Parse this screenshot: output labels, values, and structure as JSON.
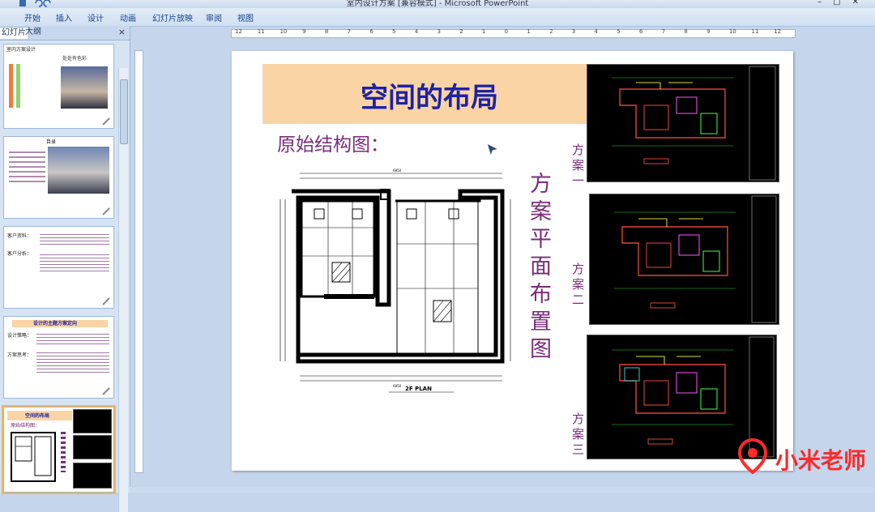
{
  "window": {
    "title": "室内设计方案 [兼容模式] - Microsoft PowerPoint"
  },
  "ribbon": {
    "tabs": [
      "开始",
      "插入",
      "设计",
      "动画",
      "幻灯片放映",
      "审阅",
      "视图"
    ]
  },
  "pane": {
    "tab_slides": "幻灯片",
    "tab_outline": "大纲",
    "close_icon": "×"
  },
  "thumbs": {
    "t1": {
      "title": "室内方案设计",
      "caption": "处处有色彩"
    },
    "t2": {
      "title": "目录"
    },
    "t3": {
      "label1": "客户资料：",
      "label2": "客户分析："
    },
    "t4": {
      "title": "设计的主题方案定向",
      "label1": "设计策略：",
      "label2": "方案思考："
    },
    "t5": {
      "title": "空间的布局",
      "sub": "原始结构图："
    }
  },
  "ruler": {
    "h_ticks": [
      "12",
      "11",
      "10",
      "9",
      "8",
      "7",
      "6",
      "5",
      "4",
      "3",
      "2",
      "1",
      "0",
      "1",
      "2",
      "3",
      "4",
      "5",
      "6",
      "7",
      "8",
      "9",
      "10",
      "11",
      "12"
    ]
  },
  "slide": {
    "title": "空间的布局",
    "subtitle": "原始结构图：",
    "vertical_label": "方案平面布置图",
    "plan_labels": [
      "方案一",
      "方案二",
      "方案三"
    ],
    "plan_caption": "2F PLAN"
  },
  "watermark": {
    "text": "小米老师"
  },
  "colors": {
    "title_box": "#fbd4a5",
    "title_text": "#1c22a6",
    "accent_text": "#7a2c7a",
    "cad_bg": "#000000"
  }
}
